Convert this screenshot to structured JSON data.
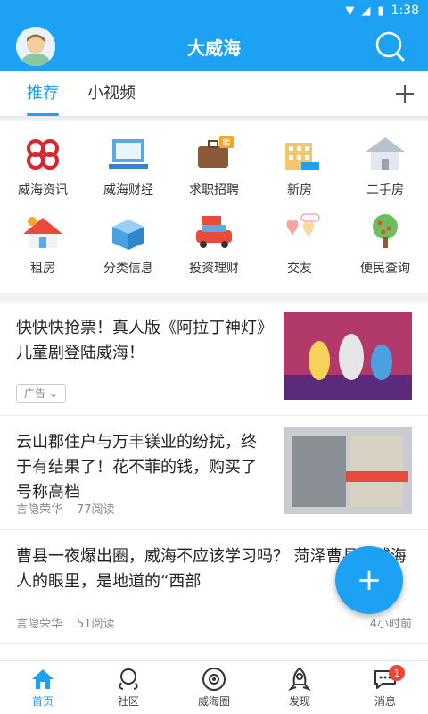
{
  "status": {
    "time": "1:38"
  },
  "header": {
    "title": "大威海"
  },
  "tabs": [
    {
      "label": "推荐"
    },
    {
      "label": "小视频"
    }
  ],
  "services": [
    {
      "label": "威海资讯",
      "icon": "knot-icon"
    },
    {
      "label": "威海财经",
      "icon": "screen-icon"
    },
    {
      "label": "求职招聘",
      "icon": "briefcase-icon"
    },
    {
      "label": "新房",
      "icon": "building-icon"
    },
    {
      "label": "二手房",
      "icon": "house-old-icon"
    },
    {
      "label": "租房",
      "icon": "house-icon"
    },
    {
      "label": "分类信息",
      "icon": "box-icon"
    },
    {
      "label": "投资理财",
      "icon": "car-icon"
    },
    {
      "label": "交友",
      "icon": "love-icon"
    },
    {
      "label": "便民查询",
      "icon": "tree-icon"
    }
  ],
  "feed": [
    {
      "title": "快快快抢票！真人版《阿拉丁神灯》儿童剧登陆威海！",
      "ad": "广告"
    },
    {
      "title": "云山郡住户与万丰镁业的纷扰，终于有结果了！花不菲的钱，购买了号称高档",
      "author": "言隐荣华",
      "reads": "77阅读"
    },
    {
      "title": "曹县一夜爆出圈，威海不应该学习吗？  菏泽曹县在威海人的眼里，是地道的“西部",
      "author": "言隐荣华",
      "reads": "51阅读",
      "time": "4小时前"
    }
  ],
  "bottom_nav": [
    {
      "label": "首页"
    },
    {
      "label": "社区"
    },
    {
      "label": "威海圈"
    },
    {
      "label": "发现"
    },
    {
      "label": "消息",
      "badge": "1"
    }
  ],
  "colors": {
    "primary": "#1da1f2",
    "badge": "#f44336"
  }
}
